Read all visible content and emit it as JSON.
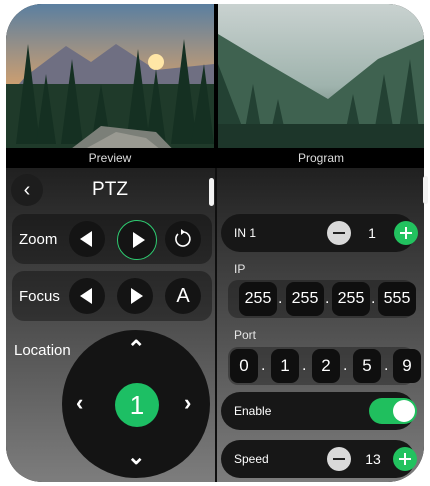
{
  "panes": {
    "preview_label": "Preview",
    "program_label": "Program"
  },
  "ptz": {
    "title": "PTZ",
    "zoom_label": "Zoom",
    "focus_label": "Focus",
    "focus_auto_label": "A",
    "location_label": "Location",
    "location_preset": "1"
  },
  "right": {
    "input_label": "IN 1",
    "input_value": "1",
    "ip_label": "IP",
    "ip_octets": [
      "255",
      "255",
      "255",
      "555"
    ],
    "port_label": "Port",
    "port_digits": [
      "0",
      "1",
      "2",
      "5",
      "9"
    ],
    "enable_label": "Enable",
    "enable_on": true,
    "speed_label": "Speed",
    "speed_value": "13"
  },
  "colors": {
    "accent": "#22c25f",
    "panel_dark": "#171717"
  },
  "icons": {
    "back": "chevron-left-icon",
    "rotate": "rotate-ccw-icon"
  }
}
